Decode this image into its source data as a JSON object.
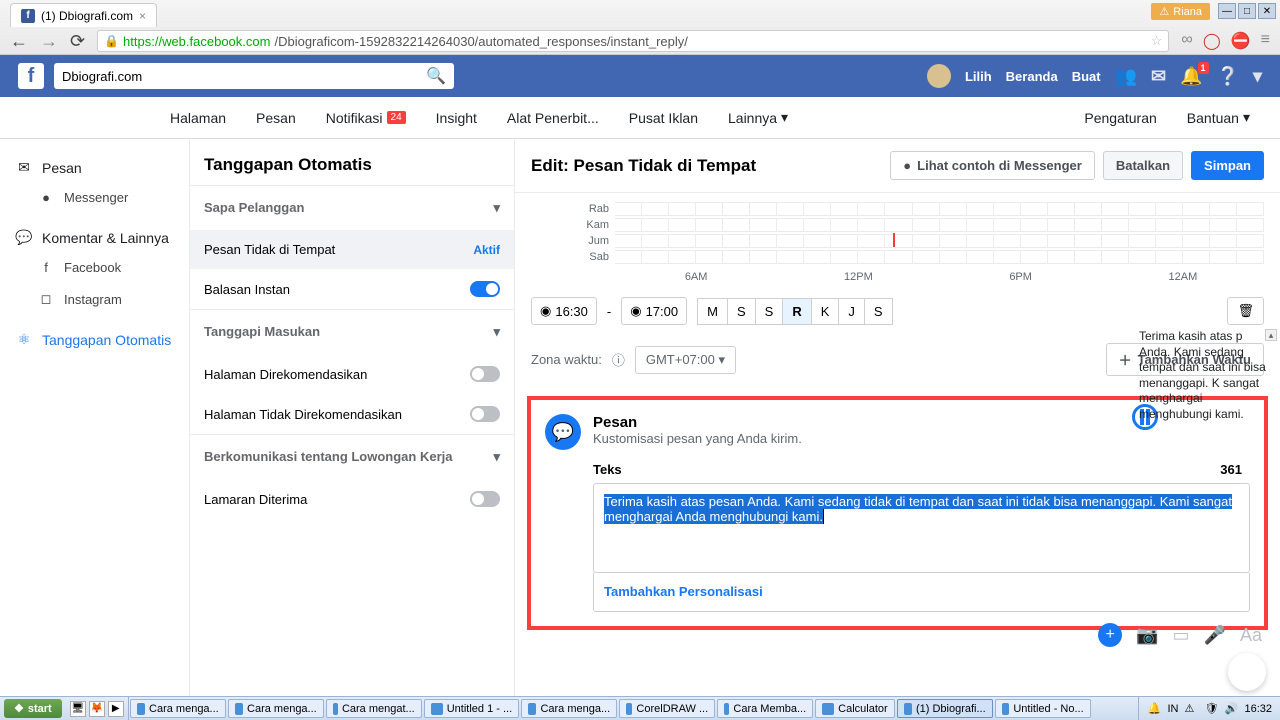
{
  "browser": {
    "tab_title": "(1) Dbiografi.com",
    "user_badge": "Riana",
    "url_host": "https://web.facebook.com",
    "url_path": "/Dbiograficom-1592832214264030/automated_responses/instant_reply/"
  },
  "fb": {
    "search_value": "Dbiografi.com",
    "user": "Lilih",
    "beranda": "Beranda",
    "buat": "Buat",
    "notif_count": "1"
  },
  "pagenav": {
    "halaman": "Halaman",
    "pesan": "Pesan",
    "notif": "Notifikasi",
    "notif_count": "24",
    "insight": "Insight",
    "alat": "Alat Penerbit...",
    "pusat": "Pusat Iklan",
    "lainnya": "Lainnya",
    "pengaturan": "Pengaturan",
    "bantuan": "Bantuan"
  },
  "left": {
    "pesan": "Pesan",
    "messenger": "Messenger",
    "komentar": "Komentar & Lainnya",
    "facebook": "Facebook",
    "instagram": "Instagram",
    "tanggapan": "Tanggapan Otomatis"
  },
  "mid": {
    "title": "Tanggapan Otomatis",
    "sapa": "Sapa Pelanggan",
    "ptdt": "Pesan Tidak di Tempat",
    "aktif": "Aktif",
    "balasan": "Balasan Instan",
    "masukan": "Tanggapi Masukan",
    "hdr": "Halaman Direkomendasikan",
    "htdr": "Halaman Tidak Direkomendasikan",
    "lowongan": "Berkomunikasi tentang Lowongan Kerja",
    "lamaran": "Lamaran Diterima"
  },
  "content": {
    "title": "Edit: Pesan Tidak di Tempat",
    "lihat": "Lihat contoh di Messenger",
    "batalkan": "Batalkan",
    "simpan": "Simpan",
    "days": [
      "Rab",
      "Kam",
      "Jum",
      "Sab"
    ],
    "hours": [
      "6AM",
      "12PM",
      "6PM",
      "12AM"
    ],
    "t1": "16:30",
    "dash": "-",
    "t2": "17:00",
    "daybtns": [
      "M",
      "S",
      "S",
      "R",
      "K",
      "J",
      "S"
    ],
    "tz_label": "Zona waktu:",
    "tz_val": "GMT+07:00",
    "add_time": "Tambahkan Waktu",
    "msg_title": "Pesan",
    "msg_sub": "Kustomisasi pesan yang Anda kirim.",
    "teks": "Teks",
    "count": "361",
    "body": "Terima kasih atas pesan Anda. Kami sedang tidak di tempat dan saat ini tidak bisa menanggapi. Kami sangat menghargai Anda menghubungi kami.",
    "pers": "Tambahkan Personalisasi"
  },
  "preview": "Terima kasih atas p\nAnda. Kami sedang\ntempat dan saat ini\nbisa menanggapi. K\nsangat menghargai\nmenghubungi kami.",
  "taskbar": {
    "start": "start",
    "items": [
      "Cara menga...",
      "Cara menga...",
      "Cara mengat...",
      "Untitled 1 - ...",
      "Cara menga...",
      "CorelDRAW ...",
      "Cara Memba...",
      "Calculator",
      "(1) Dbiografi...",
      "Untitled - No..."
    ],
    "lang": "IN",
    "time": "16:32"
  }
}
